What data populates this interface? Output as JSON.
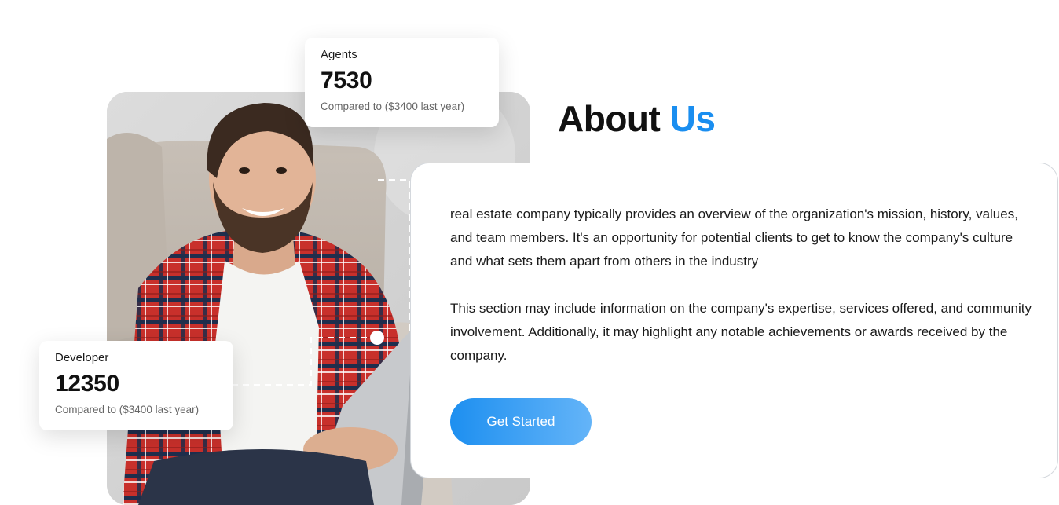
{
  "stats": {
    "agents": {
      "title": "Agents",
      "value": "7530",
      "note": "Compared to ($3400 last year)"
    },
    "developer": {
      "title": "Developer",
      "value": "12350",
      "note": "Compared to ($3400 last year)"
    }
  },
  "about": {
    "heading_main": "About",
    "heading_accent": "Us",
    "paragraph_1": "real estate company typically provides an overview of the organization's mission, history, values, and team members. It's an opportunity for potential clients to get to know the company's culture and what sets them apart from others in the industry",
    "paragraph_2": "This section may include information on the company's expertise, services offered, and community involvement. Additionally, it may highlight any notable achievements or awards received by the company.",
    "cta_label": "Get Started"
  },
  "colors": {
    "accent": "#1a8ef0",
    "button_gradient_start": "#1d8ff0",
    "button_gradient_end": "#64b4f8"
  }
}
